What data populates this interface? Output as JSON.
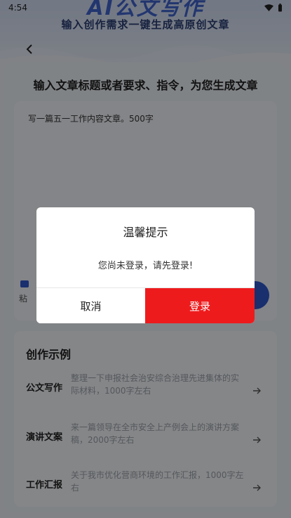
{
  "status_bar": {
    "time": "4:54"
  },
  "header": {
    "hero_title": "AI公文写作",
    "subtitle": "输入创作需求一键生成高原创文章"
  },
  "main": {
    "prompt_title": "输入文章标题或者要求、指令，为您生成文章",
    "editor_text": "写一篇五一工作内容文章。500字",
    "paste_label": "粘"
  },
  "examples": {
    "title": "创作示例",
    "items": [
      {
        "category": "公文写作",
        "text": "整理一下申报社会治安综合治理先进集体的实际材料，1000字左右"
      },
      {
        "category": "演讲文案",
        "text": "来一篇领导在全市安全上产例会上的演讲方案稿，2000字左右"
      },
      {
        "category": "工作汇报",
        "text": "关于我市优化营商环境的工作汇报，1000字左右"
      }
    ]
  },
  "dialog": {
    "title": "温馨提示",
    "message": "您尚未登录，请先登录!",
    "cancel_label": "取消",
    "login_label": "登录"
  },
  "colors": {
    "accent": "#2f56c8",
    "login": "#ee1b1d"
  }
}
